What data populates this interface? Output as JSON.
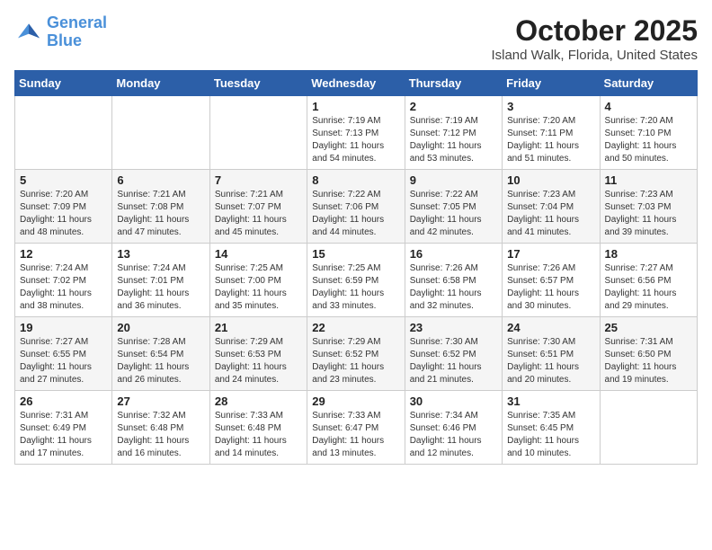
{
  "header": {
    "logo_line1": "General",
    "logo_line2": "Blue",
    "title": "October 2025",
    "location": "Island Walk, Florida, United States"
  },
  "weekdays": [
    "Sunday",
    "Monday",
    "Tuesday",
    "Wednesday",
    "Thursday",
    "Friday",
    "Saturday"
  ],
  "weeks": [
    [
      {
        "day": "",
        "info": ""
      },
      {
        "day": "",
        "info": ""
      },
      {
        "day": "",
        "info": ""
      },
      {
        "day": "1",
        "info": "Sunrise: 7:19 AM\nSunset: 7:13 PM\nDaylight: 11 hours and 54 minutes."
      },
      {
        "day": "2",
        "info": "Sunrise: 7:19 AM\nSunset: 7:12 PM\nDaylight: 11 hours and 53 minutes."
      },
      {
        "day": "3",
        "info": "Sunrise: 7:20 AM\nSunset: 7:11 PM\nDaylight: 11 hours and 51 minutes."
      },
      {
        "day": "4",
        "info": "Sunrise: 7:20 AM\nSunset: 7:10 PM\nDaylight: 11 hours and 50 minutes."
      }
    ],
    [
      {
        "day": "5",
        "info": "Sunrise: 7:20 AM\nSunset: 7:09 PM\nDaylight: 11 hours and 48 minutes."
      },
      {
        "day": "6",
        "info": "Sunrise: 7:21 AM\nSunset: 7:08 PM\nDaylight: 11 hours and 47 minutes."
      },
      {
        "day": "7",
        "info": "Sunrise: 7:21 AM\nSunset: 7:07 PM\nDaylight: 11 hours and 45 minutes."
      },
      {
        "day": "8",
        "info": "Sunrise: 7:22 AM\nSunset: 7:06 PM\nDaylight: 11 hours and 44 minutes."
      },
      {
        "day": "9",
        "info": "Sunrise: 7:22 AM\nSunset: 7:05 PM\nDaylight: 11 hours and 42 minutes."
      },
      {
        "day": "10",
        "info": "Sunrise: 7:23 AM\nSunset: 7:04 PM\nDaylight: 11 hours and 41 minutes."
      },
      {
        "day": "11",
        "info": "Sunrise: 7:23 AM\nSunset: 7:03 PM\nDaylight: 11 hours and 39 minutes."
      }
    ],
    [
      {
        "day": "12",
        "info": "Sunrise: 7:24 AM\nSunset: 7:02 PM\nDaylight: 11 hours and 38 minutes."
      },
      {
        "day": "13",
        "info": "Sunrise: 7:24 AM\nSunset: 7:01 PM\nDaylight: 11 hours and 36 minutes."
      },
      {
        "day": "14",
        "info": "Sunrise: 7:25 AM\nSunset: 7:00 PM\nDaylight: 11 hours and 35 minutes."
      },
      {
        "day": "15",
        "info": "Sunrise: 7:25 AM\nSunset: 6:59 PM\nDaylight: 11 hours and 33 minutes."
      },
      {
        "day": "16",
        "info": "Sunrise: 7:26 AM\nSunset: 6:58 PM\nDaylight: 11 hours and 32 minutes."
      },
      {
        "day": "17",
        "info": "Sunrise: 7:26 AM\nSunset: 6:57 PM\nDaylight: 11 hours and 30 minutes."
      },
      {
        "day": "18",
        "info": "Sunrise: 7:27 AM\nSunset: 6:56 PM\nDaylight: 11 hours and 29 minutes."
      }
    ],
    [
      {
        "day": "19",
        "info": "Sunrise: 7:27 AM\nSunset: 6:55 PM\nDaylight: 11 hours and 27 minutes."
      },
      {
        "day": "20",
        "info": "Sunrise: 7:28 AM\nSunset: 6:54 PM\nDaylight: 11 hours and 26 minutes."
      },
      {
        "day": "21",
        "info": "Sunrise: 7:29 AM\nSunset: 6:53 PM\nDaylight: 11 hours and 24 minutes."
      },
      {
        "day": "22",
        "info": "Sunrise: 7:29 AM\nSunset: 6:52 PM\nDaylight: 11 hours and 23 minutes."
      },
      {
        "day": "23",
        "info": "Sunrise: 7:30 AM\nSunset: 6:52 PM\nDaylight: 11 hours and 21 minutes."
      },
      {
        "day": "24",
        "info": "Sunrise: 7:30 AM\nSunset: 6:51 PM\nDaylight: 11 hours and 20 minutes."
      },
      {
        "day": "25",
        "info": "Sunrise: 7:31 AM\nSunset: 6:50 PM\nDaylight: 11 hours and 19 minutes."
      }
    ],
    [
      {
        "day": "26",
        "info": "Sunrise: 7:31 AM\nSunset: 6:49 PM\nDaylight: 11 hours and 17 minutes."
      },
      {
        "day": "27",
        "info": "Sunrise: 7:32 AM\nSunset: 6:48 PM\nDaylight: 11 hours and 16 minutes."
      },
      {
        "day": "28",
        "info": "Sunrise: 7:33 AM\nSunset: 6:48 PM\nDaylight: 11 hours and 14 minutes."
      },
      {
        "day": "29",
        "info": "Sunrise: 7:33 AM\nSunset: 6:47 PM\nDaylight: 11 hours and 13 minutes."
      },
      {
        "day": "30",
        "info": "Sunrise: 7:34 AM\nSunset: 6:46 PM\nDaylight: 11 hours and 12 minutes."
      },
      {
        "day": "31",
        "info": "Sunrise: 7:35 AM\nSunset: 6:45 PM\nDaylight: 11 hours and 10 minutes."
      },
      {
        "day": "",
        "info": ""
      }
    ]
  ]
}
